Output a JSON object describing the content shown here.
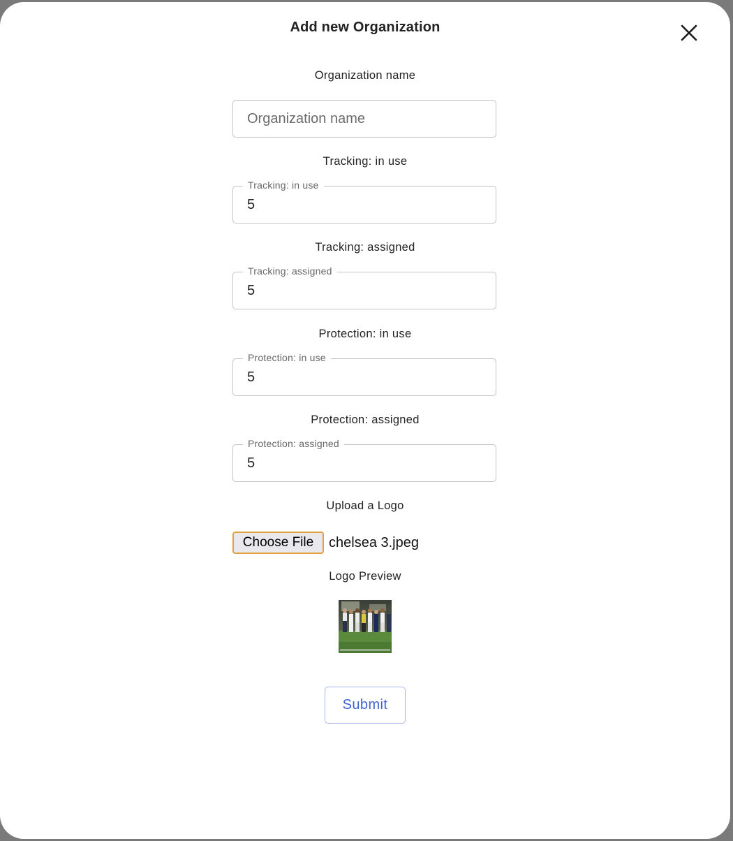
{
  "modal": {
    "title": "Add new Organization",
    "close_icon": "close-icon"
  },
  "form": {
    "org_name": {
      "label": "Organization name",
      "placeholder": "Organization name",
      "value": ""
    },
    "tracking_in_use": {
      "label": "Tracking: in use",
      "legend": "Tracking: in use",
      "value": "5"
    },
    "tracking_assigned": {
      "label": "Tracking: assigned",
      "legend": "Tracking: assigned",
      "value": "5"
    },
    "protection_in_use": {
      "label": "Protection: in use",
      "legend": "Protection: in use",
      "value": "5"
    },
    "protection_assigned": {
      "label": "Protection: assigned",
      "legend": "Protection: assigned",
      "value": "5"
    },
    "logo": {
      "label": "Upload a Logo",
      "choose_button": "Choose File",
      "file_name": "chelsea 3.jpeg",
      "preview_label": "Logo Preview"
    },
    "submit_label": "Submit"
  },
  "colors": {
    "accent": "#3f63d4",
    "focus_ring": "#e3a03d",
    "field_border": "#c4c4c4"
  }
}
